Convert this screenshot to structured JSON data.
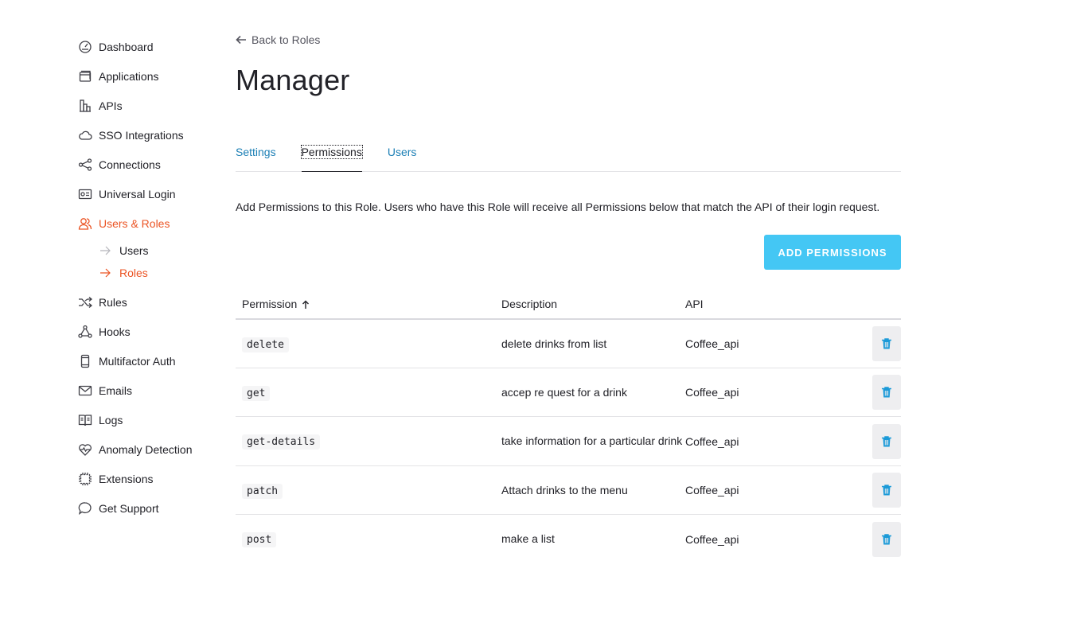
{
  "sidebar": {
    "items": [
      {
        "label": "Dashboard",
        "icon": "dashboard-icon"
      },
      {
        "label": "Applications",
        "icon": "applications-icon"
      },
      {
        "label": "APIs",
        "icon": "apis-icon"
      },
      {
        "label": "SSO Integrations",
        "icon": "cloud-icon"
      },
      {
        "label": "Connections",
        "icon": "connections-icon"
      },
      {
        "label": "Universal Login",
        "icon": "universal-login-icon"
      },
      {
        "label": "Users & Roles",
        "icon": "users-icon"
      },
      {
        "label": "Rules",
        "icon": "rules-icon"
      },
      {
        "label": "Hooks",
        "icon": "hooks-icon"
      },
      {
        "label": "Multifactor Auth",
        "icon": "phone-icon"
      },
      {
        "label": "Emails",
        "icon": "mail-icon"
      },
      {
        "label": "Logs",
        "icon": "book-icon"
      },
      {
        "label": "Anomaly Detection",
        "icon": "heart-icon"
      },
      {
        "label": "Extensions",
        "icon": "chip-icon"
      },
      {
        "label": "Get Support",
        "icon": "chat-icon"
      }
    ],
    "subitems": [
      {
        "label": "Users"
      },
      {
        "label": "Roles"
      }
    ]
  },
  "header": {
    "back_label": "Back to Roles",
    "title": "Manager"
  },
  "tabs": [
    {
      "label": "Settings"
    },
    {
      "label": "Permissions"
    },
    {
      "label": "Users"
    }
  ],
  "intro": "Add Permissions to this Role. Users who have this Role will receive all Permissions below that match the API of their login request.",
  "add_button_label": "ADD PERMISSIONS",
  "table": {
    "columns": [
      "Permission",
      "Description",
      "API"
    ],
    "rows": [
      {
        "permission": "delete",
        "description": "delete drinks from list",
        "api": "Coffee_api"
      },
      {
        "permission": "get",
        "description": "accep re quest for a drink",
        "api": "Coffee_api"
      },
      {
        "permission": "get-details",
        "description": "take information for a particular drink",
        "api": "Coffee_api"
      },
      {
        "permission": "patch",
        "description": "Attach drinks to the menu",
        "api": "Coffee_api"
      },
      {
        "permission": "post",
        "description": "make a list",
        "api": "Coffee_api"
      }
    ]
  },
  "colors": {
    "accent": "#eb5424",
    "link": "#1b7fb5",
    "button": "#44c7f4",
    "trash": "#1b9ad8"
  }
}
